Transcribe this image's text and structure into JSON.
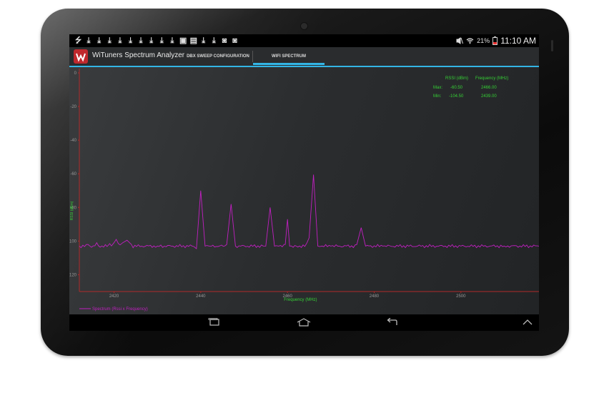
{
  "status_bar": {
    "notification_icons": [
      "usb-icon",
      "download-icon",
      "download-icon",
      "download-icon",
      "download-icon",
      "download-icon",
      "download-icon",
      "download-icon",
      "download-icon",
      "download-icon",
      "image-icon",
      "screenshot-icon",
      "download-icon",
      "download-icon",
      "camera-upload-icon",
      "camera-upload-icon"
    ],
    "battery": "21%",
    "time": "11:10 AM"
  },
  "action_bar": {
    "app_title": "WiTuners Spectrum Analyzer",
    "tabs": [
      {
        "label": "DBX SWEEP CONFIGURATION",
        "active": false
      },
      {
        "label": "WIFI SPECTRUM",
        "active": true
      }
    ],
    "accent_color": "#33b5e5"
  },
  "stats": {
    "col_rssi": "RSSI (dBm)",
    "col_freq": "Frequency (MHz)",
    "max_label": "Max:",
    "max_rssi": "-60.50",
    "max_freq": "2466.00",
    "min_label": "Min:",
    "min_rssi": "-104.50",
    "min_freq": "2439.00"
  },
  "legend": {
    "label": "Spectrum (Rssi x Frequency)"
  },
  "chart_data": {
    "type": "line",
    "xlabel": "Frequency (MHz)",
    "ylabel": "RSSI (dBm)",
    "xlim": [
      2412,
      2518
    ],
    "ylim": [
      -130,
      0
    ],
    "x_ticks": [
      2420,
      2440,
      2460,
      2480,
      2500
    ],
    "y_ticks": [
      0,
      -20,
      -40,
      -60,
      -80,
      -100,
      -120
    ],
    "grid": false,
    "legend_position": "bottom-left",
    "colors": {
      "series": "#c21fc2",
      "axis_text": "#9a9a9a",
      "accent_text": "#35d135",
      "axis_line": "#b02a2a"
    },
    "series": [
      {
        "name": "Spectrum (Rssi x Frequency)",
        "baseline": -103,
        "x": [
          2412,
          2414,
          2416,
          2419,
          2420,
          2420.5,
          2421,
          2422,
          2423,
          2424,
          2430,
          2438,
          2439,
          2440,
          2441,
          2442,
          2446,
          2447,
          2448,
          2455,
          2456,
          2457,
          2458,
          2459.5,
          2460,
          2460.5,
          2462,
          2464.5,
          2465,
          2466,
          2467,
          2468,
          2470,
          2476,
          2477,
          2478,
          2482,
          2490,
          2500,
          2510,
          2518
        ],
        "y": [
          -103,
          -102,
          -101,
          -101.5,
          -101,
          -99,
          -101.5,
          -101,
          -99.5,
          -102,
          -103,
          -103,
          -104.5,
          -70,
          -103,
          -103,
          -102,
          -78,
          -103,
          -103,
          -80,
          -103,
          -103,
          -102,
          -87,
          -103,
          -103,
          -101,
          -98,
          -60.5,
          -103,
          -103,
          -103,
          -102,
          -92,
          -103,
          -103,
          -103,
          -103,
          -103,
          -103
        ]
      }
    ]
  }
}
